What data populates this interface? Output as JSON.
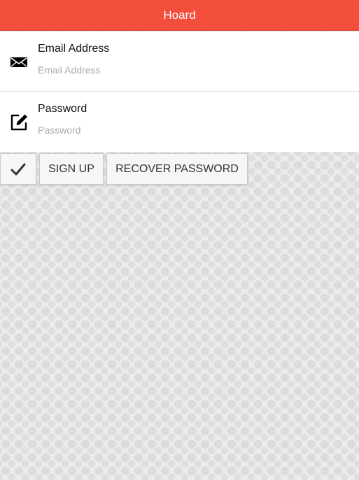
{
  "header": {
    "title": "Hoard",
    "color": "#f24e3b"
  },
  "form": {
    "email": {
      "label": "Email Address",
      "placeholder": "Email Address",
      "value": "",
      "icon": "envelope-icon"
    },
    "password": {
      "label": "Password",
      "placeholder": "Password",
      "value": "",
      "icon": "edit-icon"
    }
  },
  "buttons": {
    "submit_icon": "checkmark-icon",
    "signup_label": "SIGN UP",
    "recover_label": "RECOVER PASSWORD"
  }
}
